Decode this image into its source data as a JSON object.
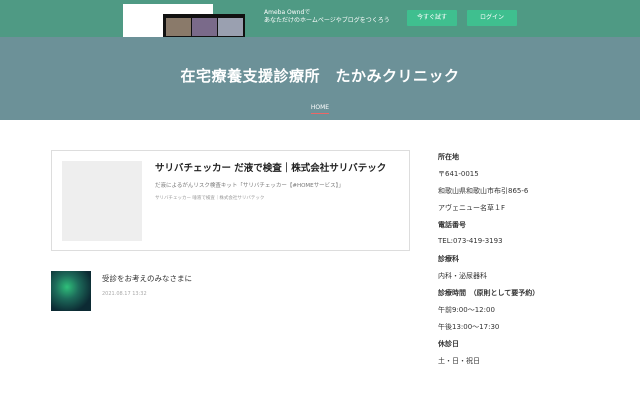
{
  "ad": {
    "text_line1": "Ameba Owndで",
    "text_line2": "あなただけのホームページやブログをつくろう",
    "try_button": "今すぐ試す",
    "login_button": "ログイン"
  },
  "header": {
    "title": "在宅療養支援診療所　たかみクリニック",
    "nav": [
      "HOME"
    ]
  },
  "featured": {
    "title": "サリバチェッカー だ液で検査｜株式会社サリバテック",
    "description": "だ液によるがんリスク検査キット「サリバチェッカー【#HOMEサービス】」",
    "source": "サリバチェッカー 唾液で検査｜株式会社サリバテック"
  },
  "posts": [
    {
      "title": "受診をお考えのみなさまに",
      "date": "2021.08.17 13:32"
    }
  ],
  "sidebar": [
    {
      "type": "heading",
      "text": "所在地"
    },
    {
      "type": "text",
      "text": "〒641-0015"
    },
    {
      "type": "text",
      "text": "和歌山県和歌山市布引865-6"
    },
    {
      "type": "text",
      "text": "アヴェニュー名草１F"
    },
    {
      "type": "heading",
      "text": "電話番号"
    },
    {
      "type": "text",
      "text": "TEL:073-419-3193"
    },
    {
      "type": "heading",
      "text": "診療科"
    },
    {
      "type": "text",
      "text": "内科・泌尿器科"
    },
    {
      "type": "heading",
      "text": "診療時間　（原則として要予約）"
    },
    {
      "type": "text",
      "text": "午前9:00〜12:00"
    },
    {
      "type": "text",
      "text": "午後13:00〜17:30"
    },
    {
      "type": "heading",
      "text": "休診日"
    },
    {
      "type": "text",
      "text": "土・日・祝日"
    }
  ]
}
